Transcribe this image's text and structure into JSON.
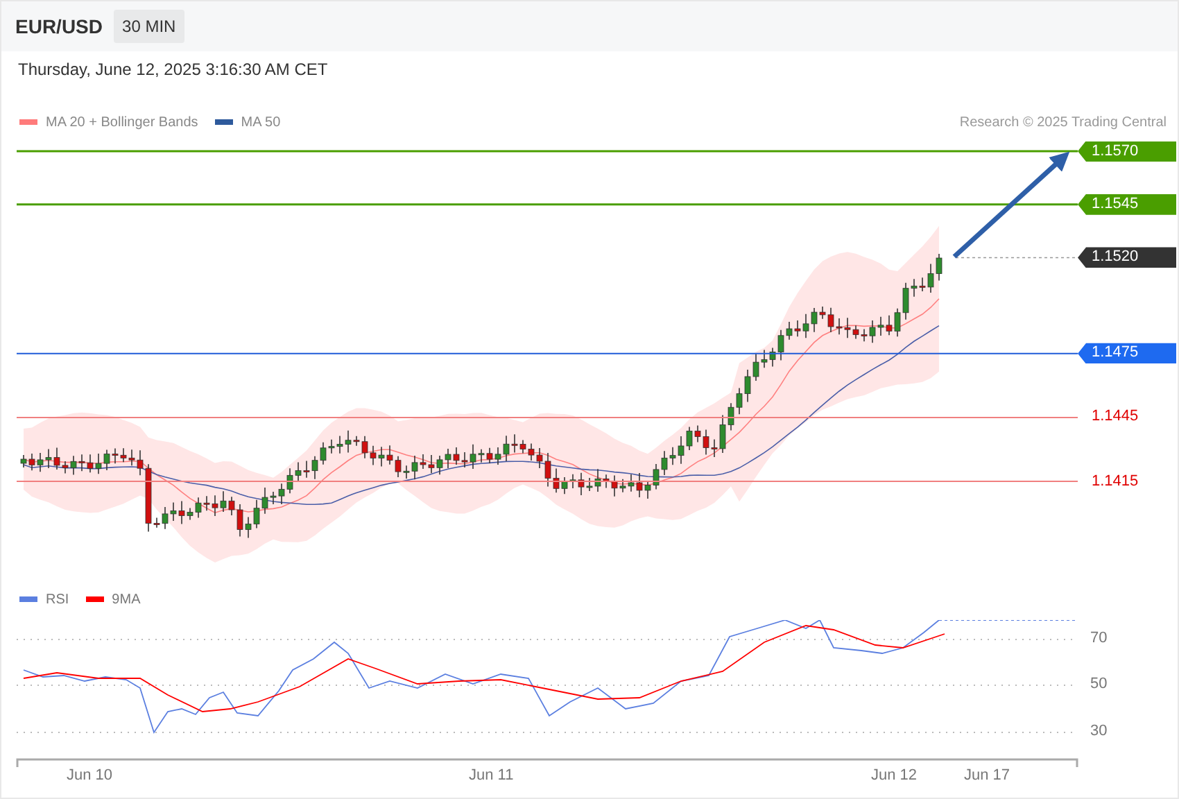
{
  "header": {
    "symbol": "EUR/USD",
    "timeframe": "30 MIN"
  },
  "timestamp": "Thursday, June 12, 2025 3:16:30 AM CET",
  "legend": [
    {
      "label": "MA 20 + Bollinger Bands",
      "color": "#ff7b7b"
    },
    {
      "label": "MA 50",
      "color": "#2e5a9c"
    }
  ],
  "credit": "Research © 2025 Trading Central",
  "levels": [
    {
      "label": "1.1570",
      "kind": "target"
    },
    {
      "label": "1.1545",
      "kind": "target"
    },
    {
      "label": "1.1520",
      "kind": "current"
    },
    {
      "label": "1.1475",
      "kind": "pivot"
    },
    {
      "label": "1.1445",
      "kind": "support"
    },
    {
      "label": "1.1415",
      "kind": "support"
    }
  ],
  "rsi": {
    "legend": [
      {
        "label": "RSI",
        "color": "#5b7fe0"
      },
      {
        "label": "9MA",
        "color": "#ff0000"
      }
    ],
    "ticks": [
      "70",
      "50",
      "30"
    ]
  },
  "dates": [
    "Jun 10",
    "Jun 11",
    "Jun 12",
    "Jun 17"
  ]
}
